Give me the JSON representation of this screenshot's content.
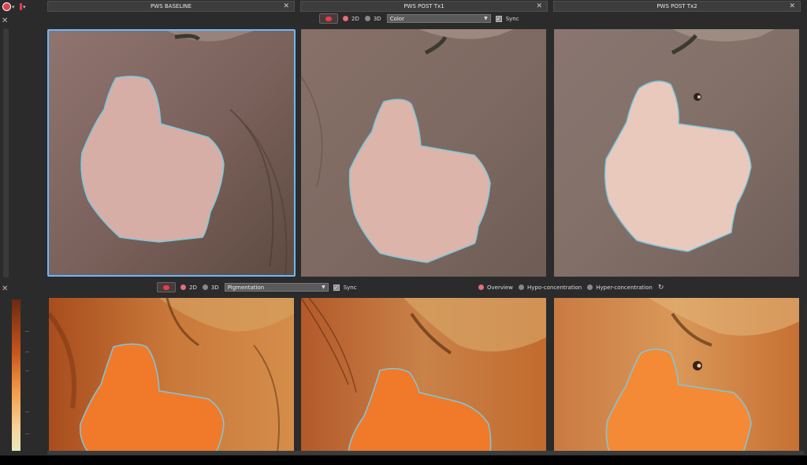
{
  "tabs": [
    {
      "label": "PWS BASELINE"
    },
    {
      "label": "PWS  POST Tx1"
    },
    {
      "label": "PWS POST Tx2"
    }
  ],
  "tab_close_glyph": "✕",
  "side_close_glyph": "✕",
  "top_toolbar": {
    "radio_2d": "2D",
    "radio_3d": "3D",
    "selected_2d": true,
    "mode_select": "Color",
    "sync_label": "Sync",
    "sync_checked": true
  },
  "bottom_toolbar": {
    "radio_2d": "2D",
    "radio_3d": "3D",
    "selected_2d": true,
    "mode_select": "Pigmentation",
    "sync_label": "Sync",
    "sync_checked": true,
    "view_options": [
      {
        "label": "Overview",
        "selected": true
      },
      {
        "label": "Hypo-concentration",
        "selected": false
      },
      {
        "label": "Hyper-concentration",
        "selected": false
      }
    ],
    "reset_icon": "refresh-icon"
  },
  "scale_ticks": [
    "—",
    "—",
    "—",
    "—",
    "—"
  ],
  "colors": {
    "accent_selected_border": "#6ab8ff",
    "outline": "#7cc8e0",
    "radio_on": "#e36f77",
    "radio_off": "#888888",
    "skin_color": "#8a6d66",
    "lesion_color": "#d9b2a8",
    "pigment_bg": "#c16a2b",
    "pigment_lesion": "#f0782a"
  }
}
